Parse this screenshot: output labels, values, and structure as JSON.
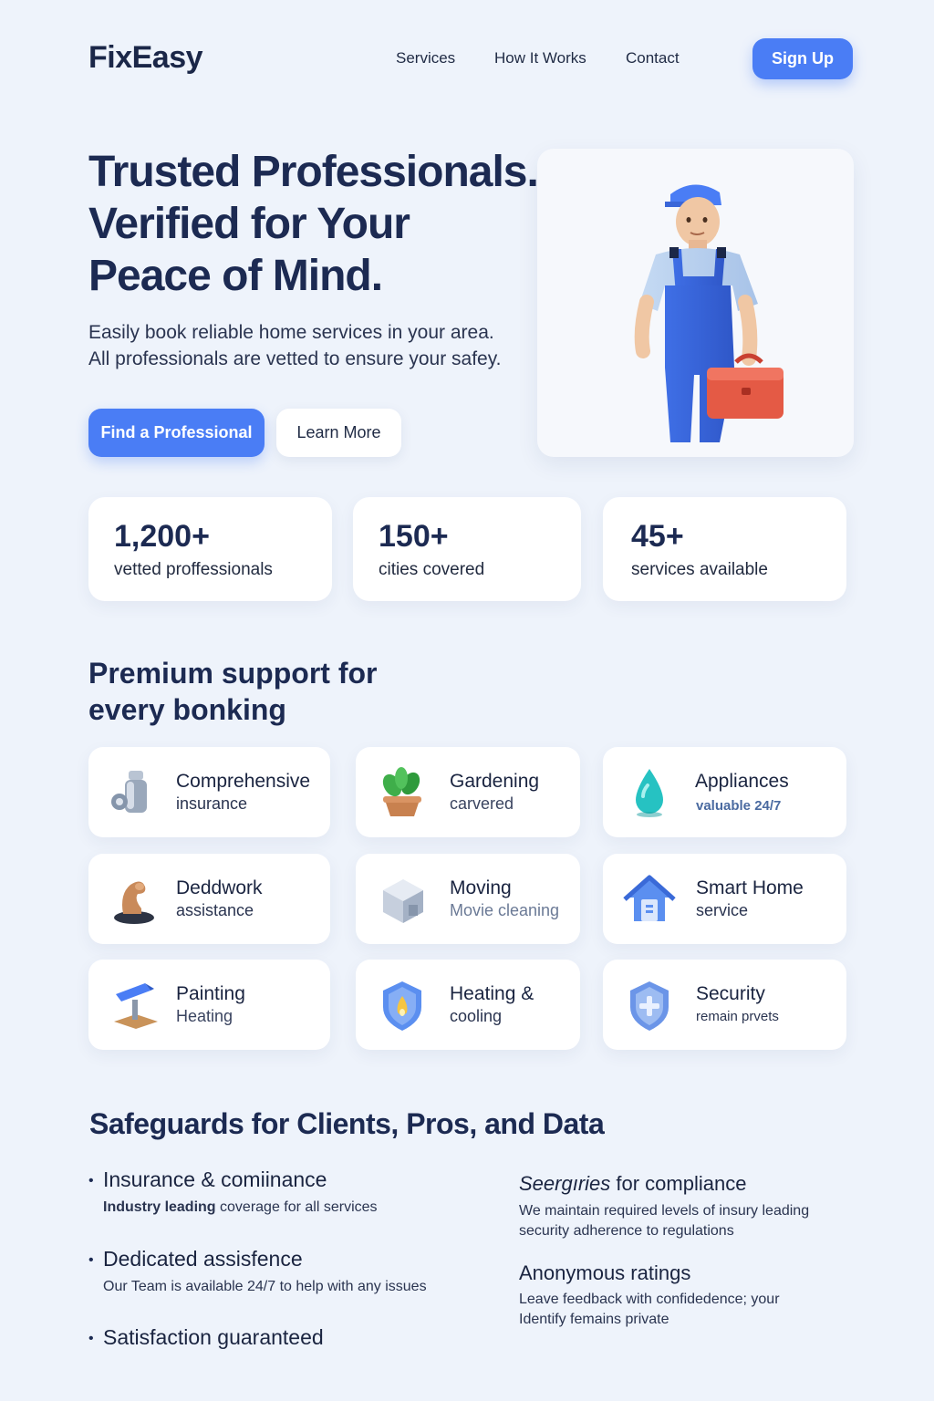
{
  "nav": {
    "logo": "FixEasy",
    "links": [
      "Services",
      "How It Works",
      "Contact"
    ],
    "signup_label": "Sign Up"
  },
  "hero": {
    "title_lines": [
      "Trusted Professionals.",
      "Verified for Your",
      "Peace of Mind."
    ],
    "subtitle_lines": [
      "Easily book reliable home services in your area.",
      "All professionals are vetted to ensure your safey."
    ],
    "primary_cta": "Find a Professional",
    "secondary_cta": "Learn More",
    "illustration": "worker-with-toolbox"
  },
  "stats": [
    {
      "value": "1,200+",
      "label": "vetted proffessionals"
    },
    {
      "value": "150+",
      "label": "cities covered"
    },
    {
      "value": "45+",
      "label": "services available"
    }
  ],
  "features_section": {
    "title_lines": [
      "Premium support for",
      "every bonking"
    ],
    "items": [
      {
        "title": "Comprehensive",
        "subtitle": "insurance",
        "icon": "faucet-icon"
      },
      {
        "title": "Gardening",
        "subtitle": "carvered",
        "icon": "plant-icon"
      },
      {
        "title": "Appliances",
        "subtitle": "valuable 24/7",
        "icon": "water-drop-icon"
      },
      {
        "title": "Deddwork",
        "subtitle": "assistance",
        "icon": "arm-icon"
      },
      {
        "title": "Moving",
        "subtitle": "Movie cleaning",
        "icon": "box-icon"
      },
      {
        "title": "Smart Home",
        "subtitle": "service",
        "icon": "house-icon"
      },
      {
        "title": "Painting",
        "subtitle": "Heating",
        "icon": "paint-roller-icon"
      },
      {
        "title": "Heating &",
        "subtitle": "cooling",
        "icon": "flame-shield-icon"
      },
      {
        "title": "Security",
        "subtitle": "remain prvets",
        "icon": "shield-plus-icon"
      }
    ]
  },
  "safeguards": {
    "title": "Safeguards for Clients, Pros, and Data",
    "left": [
      {
        "head": "Insurance & comiinance",
        "body_bold": "Industry leading",
        "body": " coverage for all services"
      },
      {
        "head": "Dedicated assisfence",
        "body": "Our Team is available 24/7 to help with any issues"
      },
      {
        "head": "Satisfaction guaranteed",
        "body": ""
      }
    ],
    "right": [
      {
        "head_italic": "Seergıries",
        "head": " for compliance",
        "body_lines": [
          "We maintain required levels of insury leading",
          "security adherence to regulations"
        ]
      },
      {
        "head": "Anonymous ratings",
        "body_lines": [
          "Leave feedback with confidedence; your",
          "Identify femains private"
        ]
      }
    ]
  },
  "colors": {
    "accent": "#4a7df5",
    "heading": "#1c2a52",
    "background": "#eef3fb"
  }
}
